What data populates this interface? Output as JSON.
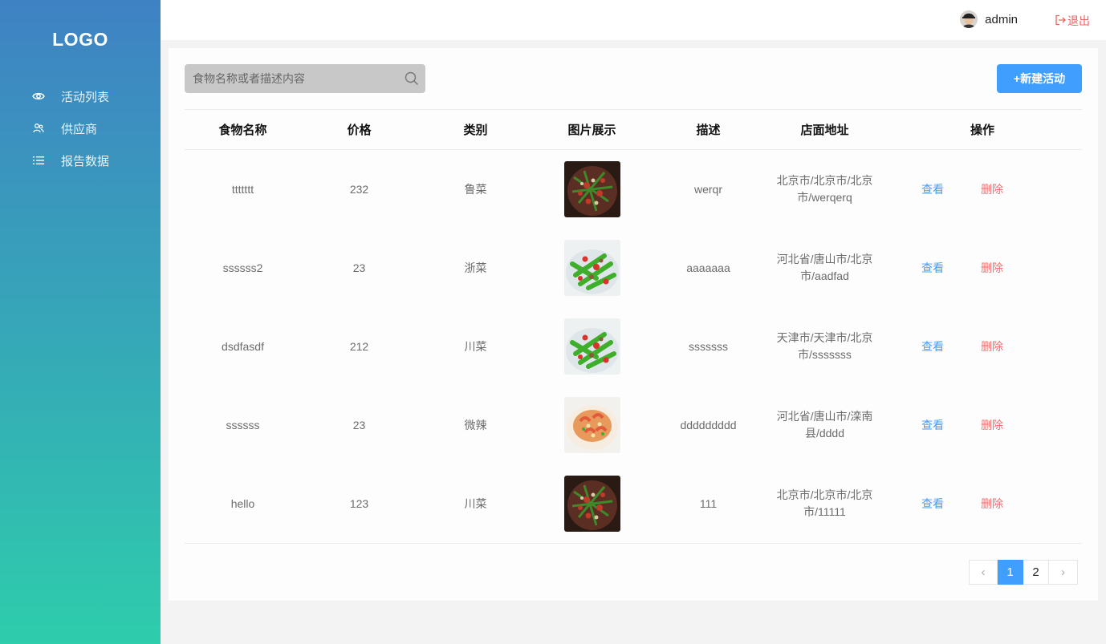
{
  "sidebar": {
    "logo": "LOGO",
    "items": [
      {
        "label": "活动列表",
        "icon": "eye-icon"
      },
      {
        "label": "供应商",
        "icon": "users-icon"
      },
      {
        "label": "报告数据",
        "icon": "list-icon"
      }
    ]
  },
  "header": {
    "username": "admin",
    "logout_label": "退出"
  },
  "toolbar": {
    "search_placeholder": "食物名称或者描述内容",
    "new_button_label": "+新建活动"
  },
  "table": {
    "columns": [
      "食物名称",
      "价格",
      "类别",
      "图片展示",
      "描述",
      "店面地址",
      "操作"
    ],
    "rows": [
      {
        "name": "ttttttt",
        "price": "232",
        "category": "鲁菜",
        "image": "stir-fry-dark",
        "desc": "werqr",
        "address": "北京市/北京市/北京市/werqerq"
      },
      {
        "name": "ssssss2",
        "price": "23",
        "category": "浙菜",
        "image": "green-beans",
        "desc": "aaaaaaa",
        "address": "河北省/唐山市/北京市/aadfad"
      },
      {
        "name": "dsdfasdf",
        "price": "212",
        "category": "川菜",
        "image": "green-beans",
        "desc": "sssssss",
        "address": "天津市/天津市/北京市/sssssss"
      },
      {
        "name": "ssssss",
        "price": "23",
        "category": "微辣",
        "image": "shrimp-plate",
        "desc": "ddddddddd",
        "address": "河北省/唐山市/滦南县/dddd"
      },
      {
        "name": "hello",
        "price": "123",
        "category": "川菜",
        "image": "stir-fry-dark",
        "desc": "111",
        "address": "北京市/北京市/北京市/11111"
      }
    ],
    "view_label": "查看",
    "delete_label": "删除"
  },
  "pagination": {
    "pages": [
      "1",
      "2"
    ],
    "current": "1",
    "prev": "‹",
    "next": "›"
  },
  "colors": {
    "primary": "#409eff",
    "danger": "#f56c6c",
    "sidebar_top": "#3f82c4",
    "sidebar_bottom": "#2ecdac"
  }
}
